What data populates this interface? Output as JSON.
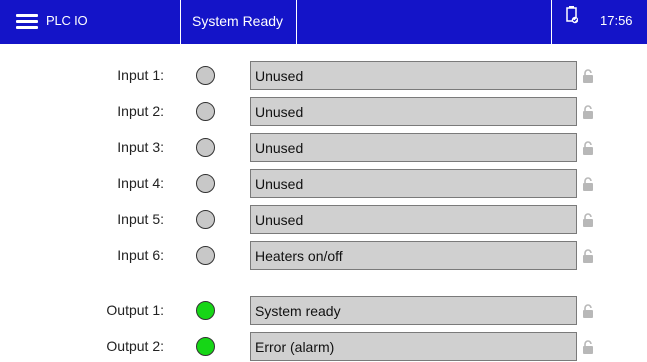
{
  "header": {
    "app_title": "PLC IO",
    "status": "System Ready",
    "battery_icon": "battery-check-icon",
    "clock": "17:56",
    "bar_color": "#1414c8"
  },
  "colors": {
    "led_off": "#c8c8c8",
    "led_on": "#16d616",
    "field_bg": "#d0d0d0"
  },
  "inputs": [
    {
      "label": "Input 1:",
      "value": "Unused",
      "active": false
    },
    {
      "label": "Input 2:",
      "value": "Unused",
      "active": false
    },
    {
      "label": "Input 3:",
      "value": "Unused",
      "active": false
    },
    {
      "label": "Input 4:",
      "value": "Unused",
      "active": false
    },
    {
      "label": "Input 5:",
      "value": "Unused",
      "active": false
    },
    {
      "label": "Input 6:",
      "value": "Heaters on/off",
      "active": false
    }
  ],
  "outputs": [
    {
      "label": "Output 1:",
      "value": "System ready",
      "active": true
    },
    {
      "label": "Output 2:",
      "value": "Error (alarm)",
      "active": true
    }
  ]
}
